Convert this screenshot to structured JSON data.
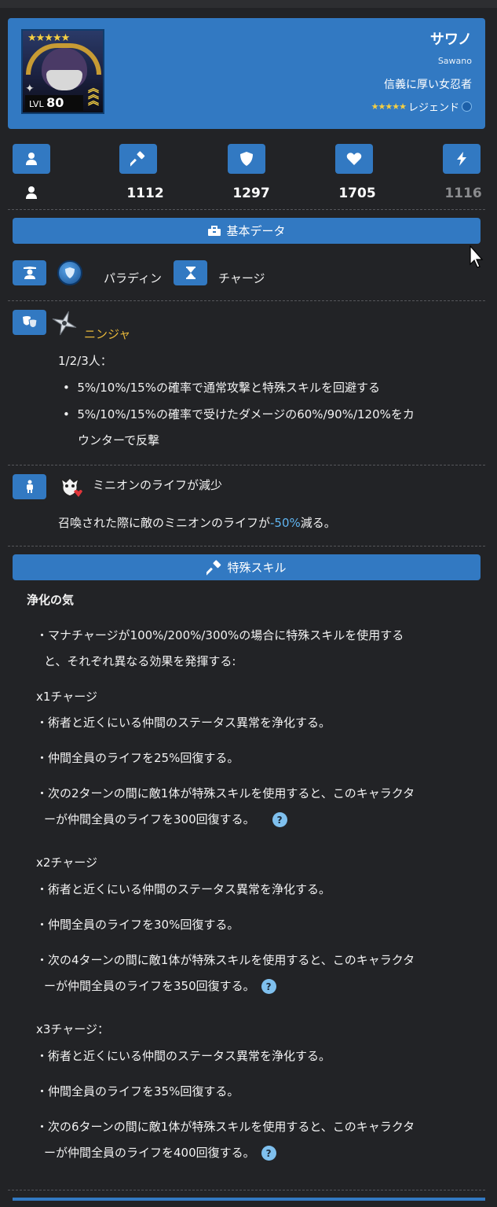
{
  "hero": {
    "name": "サワノ",
    "romaji": "Sawano",
    "title": "信義に厚い女忍者",
    "rarity_stars": "★★★★★",
    "rarity": "レジェンド",
    "level_label": "LVL",
    "level": "80",
    "portrait_stars": "★★★★★"
  },
  "stats": [
    {
      "icon": "person-icon",
      "value": ""
    },
    {
      "icon": "hammer-icon",
      "value": "1112"
    },
    {
      "icon": "shield-icon",
      "value": "1297"
    },
    {
      "icon": "heart-icon",
      "value": "1705"
    },
    {
      "icon": "lightning-icon",
      "value": "1116"
    }
  ],
  "basic_data": {
    "label": "基本データ",
    "class": "パラディン",
    "mana_speed": "チャージ"
  },
  "family": {
    "name": "ニンジャ",
    "heading": "1/2/3人：",
    "bullets": [
      "5%/10%/15%の確率で通常攻撃と特殊スキルを回避する",
      "5%/10%/15%の確率で受けたダメージの60%/90%/120%をカ",
      "ウンターで反撃"
    ]
  },
  "minion": {
    "name": "ミニオンのライフが減少",
    "desc_prefix": "召喚された際に敵のミニオンのライフが",
    "desc_value": "-50%",
    "desc_suffix": "減る。"
  },
  "special": {
    "section_label": "特殊スキル",
    "skill_name": "浄化の気",
    "intro_1": "・マナチャージが100%/200%/300%の場合に特殊スキルを使用する",
    "intro_2": "と、それぞれ異なる効果を発揮する:",
    "charges": [
      {
        "label": "x1チャージ",
        "line1": "・術者と近くにいる仲間のステータス異常を浄化する。",
        "line2": "・仲間全員のライフを25%回復する。",
        "line3a": "・次の2ターンの間に敵1体が特殊スキルを使用すると、このキャラクタ",
        "line3b": "ーが仲間全員のライフを300回復する。"
      },
      {
        "label": "x2チャージ",
        "line1": "・術者と近くにいる仲間のステータス異常を浄化する。",
        "line2": "・仲間全員のライフを30%回復する。",
        "line3a": "・次の4ターンの間に敵1体が特殊スキルを使用すると、このキャラクタ",
        "line3b": "ーが仲間全員のライフを350回復する。"
      },
      {
        "label": "x3チャージ：",
        "line1": "・術者と近くにいる仲間のステータス異常を浄化する。",
        "line2": "・仲間全員のライフを35%回復する。",
        "line3a": "・次の6ターンの間に敵1体が特殊スキルを使用すると、このキャラクタ",
        "line3b": "ーが仲間全員のライフを400回復する。"
      }
    ],
    "help_glyph": "?"
  },
  "colors": {
    "accent": "#3279c2",
    "background": "#222326",
    "gold": "#e8b83a",
    "highlight": "#5fb4f0"
  }
}
